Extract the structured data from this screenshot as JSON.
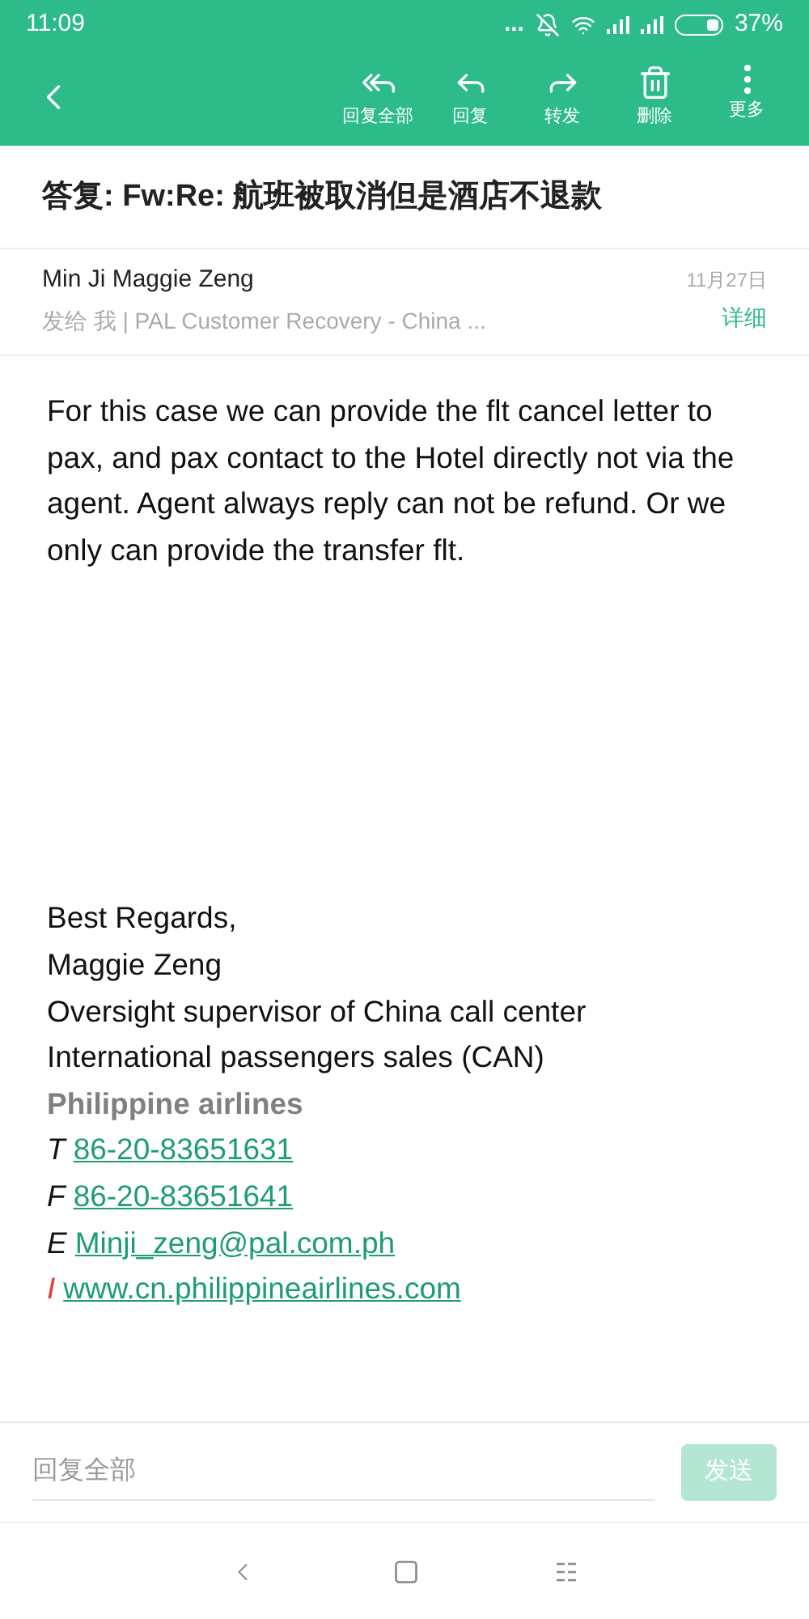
{
  "status_bar": {
    "time": "11:09",
    "dots": "...",
    "battery": "37%"
  },
  "toolbar": {
    "actions": [
      {
        "kind": "reply_all",
        "label": "回复全部"
      },
      {
        "kind": "reply",
        "label": "回复"
      },
      {
        "kind": "forward",
        "label": "转发"
      },
      {
        "kind": "delete",
        "label": "删除"
      },
      {
        "kind": "more",
        "label": "更多"
      }
    ]
  },
  "subject": "答复:  Fw:Re:  航班被取消但是酒店不退款",
  "sender": {
    "name": "Min Ji Maggie Zeng",
    "date": "11月27日",
    "recipients": "发给 我 | PAL Customer Recovery - China ...",
    "details": "详细"
  },
  "body": "For this case we can provide the flt cancel letter to pax, and pax contact to the Hotel directly not via the agent. Agent always reply can not be refund. Or we only can provide the transfer flt.",
  "signature": [
    {
      "kind": "plain",
      "text": "Best Regards,"
    },
    {
      "kind": "plain",
      "text": "Maggie Zeng"
    },
    {
      "kind": "plain",
      "text": "Oversight supervisor of China call center"
    },
    {
      "kind": "plain",
      "text": "International passengers sales (CAN)"
    },
    {
      "kind": "company",
      "text": "Philippine airlines"
    },
    {
      "kind": "contact",
      "prefix": "T",
      "link": "86-20-83651631",
      "color": "#111111"
    },
    {
      "kind": "contact",
      "prefix": "F",
      "link": "86-20-83651641",
      "color": "#111111"
    },
    {
      "kind": "contact",
      "prefix": "E",
      "link": "Minji_zeng@pal.com.ph",
      "color": "#111111"
    },
    {
      "kind": "contact",
      "prefix": "I",
      "link": "www.cn.philippineairlines.com",
      "color": "#e53935"
    }
  ],
  "reply_bar": {
    "placeholder": "回复全部",
    "send": "发送",
    "send_disabled": true
  }
}
